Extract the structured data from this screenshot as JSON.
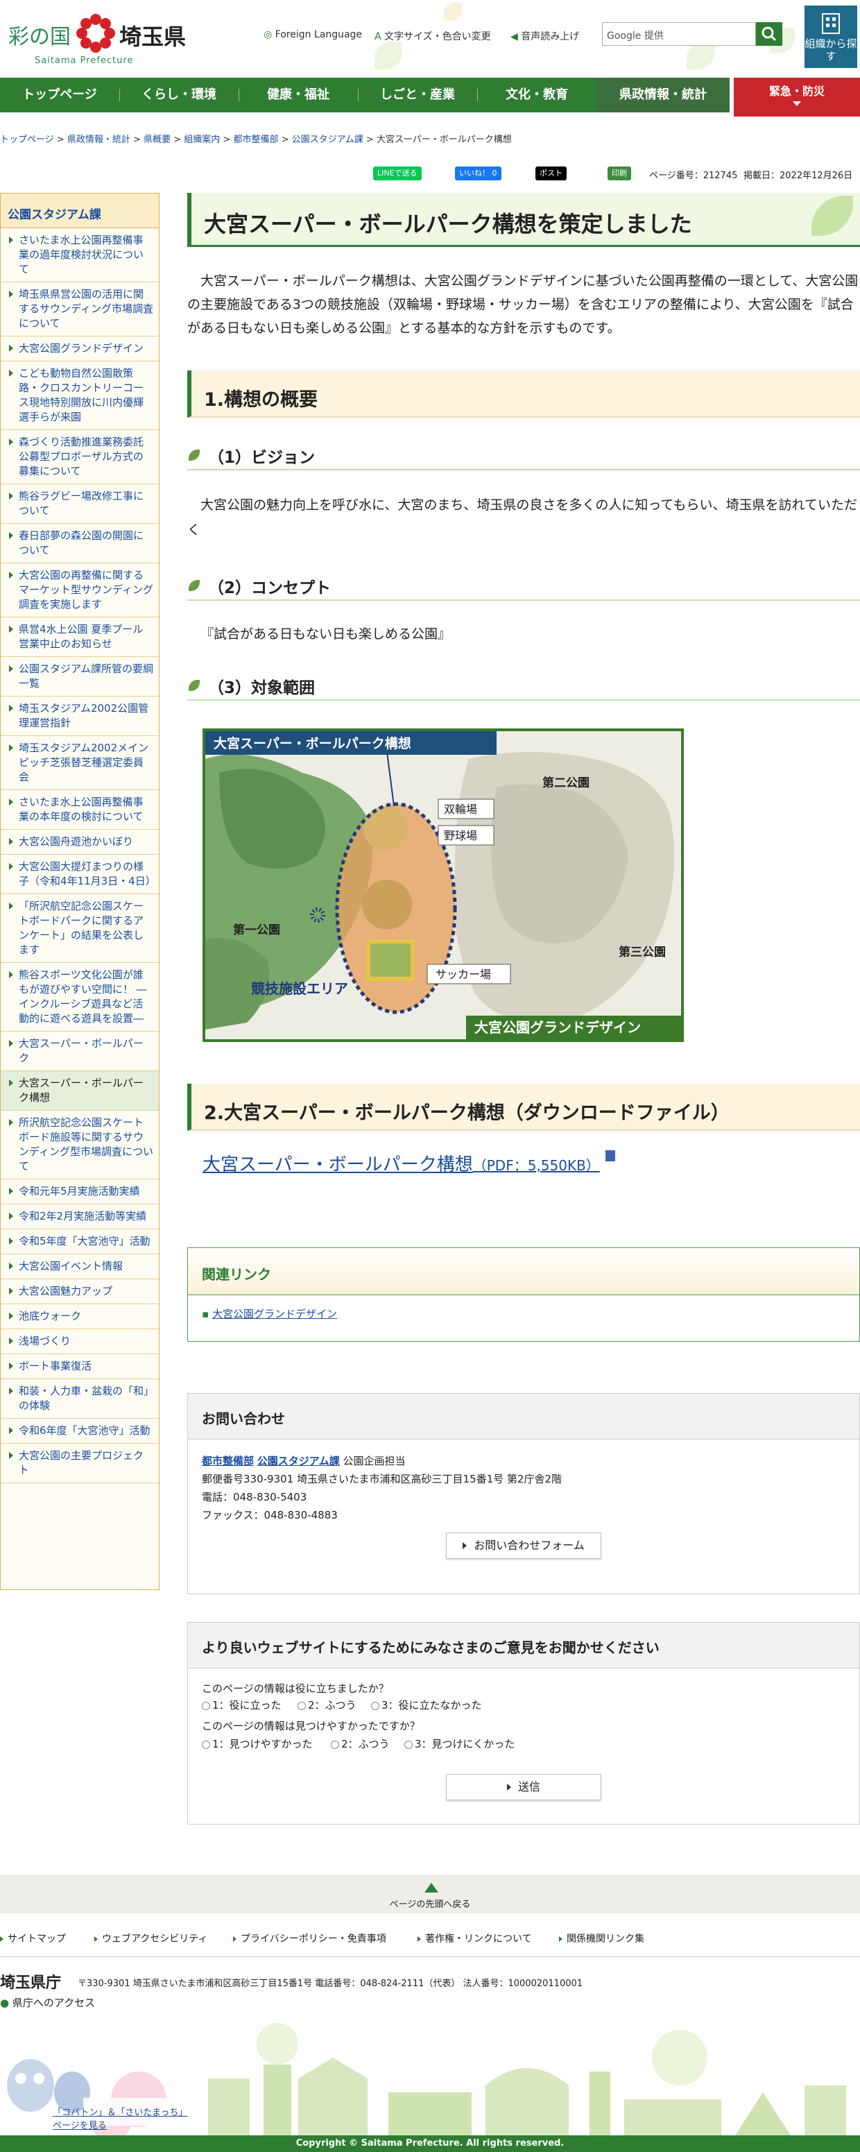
{
  "header": {
    "logo_text_1": "彩の国",
    "logo_text_2": "埼玉県",
    "logo_en": "Saitama Prefecture",
    "foreign_language": "Foreign Language",
    "font_color": "文字サイズ・色合い変更",
    "speech": "音声読み上げ",
    "search_placeholder": "Google 提供",
    "org_button": "組織から探す"
  },
  "nav": {
    "items": [
      "トップページ",
      "くらし・環境",
      "健康・福祉",
      "しごと・産業",
      "文化・教育",
      "県政情報・統計"
    ],
    "emergency": "緊急・防災"
  },
  "breadcrumb": [
    "トップページ",
    "県政情報・統計",
    "県概要",
    "組織案内",
    "都市整備部",
    "公園スタジアム課",
    "大宮スーパー・ボールパーク構想"
  ],
  "share": {
    "line": "LINEで送る",
    "fb": "いいね！ 0",
    "x": "ポスト",
    "print": "印刷",
    "page_no": "ページ番号：212745",
    "date": "掲載日：2022年12月26日"
  },
  "sidebar": {
    "title": "公園スタジアム課",
    "items": [
      "さいたま水上公園再整備事業の過年度検討状況について",
      "埼玉県県営公園の活用に関するサウンディング市場調査について",
      "大宮公園グランドデザイン",
      "こども動物自然公園散策路・クロスカントリーコース現地特別開放に川内優輝選手らが来園",
      "森づくり活動推進業務委託公募型プロポーザル方式の募集について",
      "熊谷ラグビー場改修工事について",
      "春日部夢の森公園の開園について",
      "大宮公園の再整備に関するマーケット型サウンディング調査を実施します",
      "県営4水上公園 夏季プール営業中止のお知らせ",
      "公園スタジアム課所管の要綱一覧",
      "埼玉スタジアム2002公園管理運営指針",
      "埼玉スタジアム2002メインピッチ芝張替芝種選定委員会",
      "さいたま水上公園再整備事業の本年度の検討について",
      "大宮公園舟遊池かいぼり",
      "大宮公園大提灯まつりの様子（令和4年11月3日・4日）",
      "「所沢航空記念公園スケートボードパークに関するアンケート」の結果を公表します",
      "熊谷スポーツ文化公園が誰もが遊びやすい空間に！ ―インクルーシブ遊具など活動的に遊べる遊具を設置―",
      "大宮スーパー・ボールパーク",
      "大宮スーパー・ボールパーク構想",
      "所沢航空記念公園スケートボード施設等に関するサウンディング型市場調査について",
      "令和元年5月実施活動実績",
      "令和2年2月実施活動等実績",
      "令和5年度「大宮池守」活動",
      "大宮公園イベント情報",
      "大宮公園魅力アップ",
      "池底ウォーク",
      "浅場づくり",
      "ボート事業復活",
      "和装・人力車・盆栽の「和」の体験",
      "令和6年度「大宮池守」活動",
      "大宮公園の主要プロジェクト"
    ]
  },
  "main": {
    "title": "大宮スーパー・ボールパーク構想を策定しました",
    "intro": "大宮スーパー・ボールパーク構想は、大宮公園グランドデザインに基づいた公園再整備の一環として、大宮公園の主要施設である3つの競技施設（双輪場・野球場・サッカー場）を含むエリアの整備により、大宮公園を『試合がある日もない日も楽しめる公園』とする基本的な方針を示すものです。",
    "h2_1": "1.構想の概要",
    "h3_1": "（1）ビジョン",
    "vision": "大宮公園の魅力向上を呼び水に、大宮のまち、埼玉県の良さを多くの人に知ってもらい、埼玉県を訪れていただく",
    "h3_2": "（2）コンセプト",
    "concept": "『試合がある日もない日も楽しめる公園』",
    "h3_3": "（3）対象範囲",
    "map": {
      "title": "大宮スーパー・ボールパーク構想",
      "park2": "第二公園",
      "park1": "第一公園",
      "park3": "第三公園",
      "keirin": "双輪場",
      "baseball": "野球場",
      "soccer": "サッカー場",
      "area": "競技施設エリア",
      "grand": "大宮公園グランドデザイン"
    },
    "h2_2": "2.大宮スーパー・ボールパーク構想（ダウンロードファイル）",
    "download_label": "大宮スーパー・ボールパーク構想",
    "download_size": "（PDF：5,550KB）",
    "related_title": "関連リンク",
    "related_link": "大宮公園グランドデザイン"
  },
  "contact": {
    "title": "お問い合わせ",
    "dept": "都市整備部",
    "section": "公園スタジアム課",
    "team": "公園企画担当",
    "address": "郵便番号330-9301 埼玉県さいたま市浦和区高砂三丁目15番1号 第2庁舎2階",
    "tel": "電話：048-830-5403",
    "fax": "ファックス：048-830-4883",
    "form_button": "お問い合わせフォーム"
  },
  "survey": {
    "title": "より良いウェブサイトにするためにみなさまのご意見をお聞かせください",
    "q1": "このページの情報は役に立ちましたか？",
    "q1_opts": [
      "1：役に立った",
      "2：ふつう",
      "3：役に立たなかった"
    ],
    "q2": "このページの情報は見つけやすかったですか？",
    "q2_opts": [
      "1：見つけやすかった",
      "2：ふつう",
      "3：見つけにくかった"
    ],
    "submit": "送信"
  },
  "footer": {
    "to_top": "ページの先頭へ戻る",
    "links": [
      "サイトマップ",
      "ウェブアクセシビリティ",
      "プライバシーポリシー・免責事項",
      "著作権・リンクについて",
      "関係機関リンク集"
    ],
    "org": "埼玉県庁",
    "address": "〒330-9301 埼玉県さいたま市浦和区高砂三丁目15番1号 電話番号：048-824-2111（代表） 法人番号：1000020110001",
    "access": "県庁へのアクセス",
    "mascot_text": "「コバトン」＆「さいたまっち」ページを見る",
    "copyright": "Copyright © Saitama Prefecture. All rights reserved."
  },
  "colors": {
    "primary": "#2e7d32",
    "emergency": "#c9252c",
    "org_button": "#1f6a8a"
  }
}
